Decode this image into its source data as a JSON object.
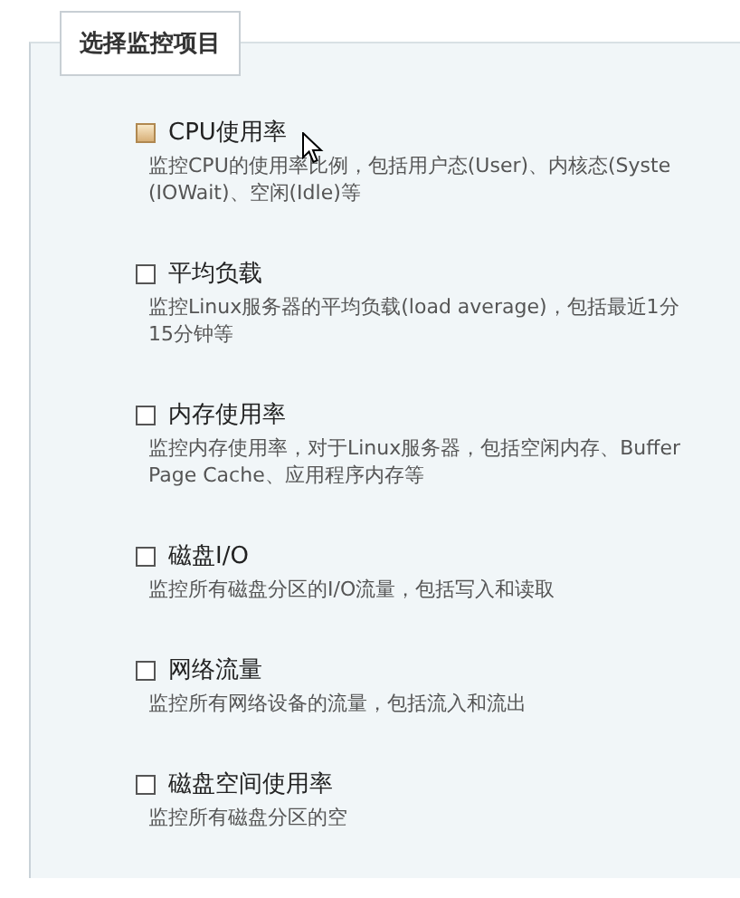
{
  "group": {
    "title": "选择监控项目"
  },
  "items": [
    {
      "label": "CPU使用率",
      "checked": false,
      "hovered": true,
      "description": [
        "监控CPU的使用率比例，包括用户态(User)、内核态(Syste",
        "(IOWait)、空闲(Idle)等"
      ]
    },
    {
      "label": "平均负载",
      "checked": false,
      "hovered": false,
      "description": [
        "监控Linux服务器的平均负载(load average)，包括最近1分",
        "15分钟等"
      ]
    },
    {
      "label": "内存使用率",
      "checked": false,
      "hovered": false,
      "description": [
        "监控内存使用率，对于Linux服务器，包括空闲内存、Buffer",
        "Page Cache、应用程序内存等"
      ]
    },
    {
      "label": "磁盘I/O",
      "checked": false,
      "hovered": false,
      "description": [
        "监控所有磁盘分区的I/O流量，包括写入和读取"
      ]
    },
    {
      "label": "网络流量",
      "checked": false,
      "hovered": false,
      "description": [
        "监控所有网络设备的流量，包括流入和流出"
      ]
    },
    {
      "label": "磁盘空间使用率",
      "checked": false,
      "hovered": false,
      "description": [
        "监控所有磁盘分区的空"
      ]
    }
  ]
}
